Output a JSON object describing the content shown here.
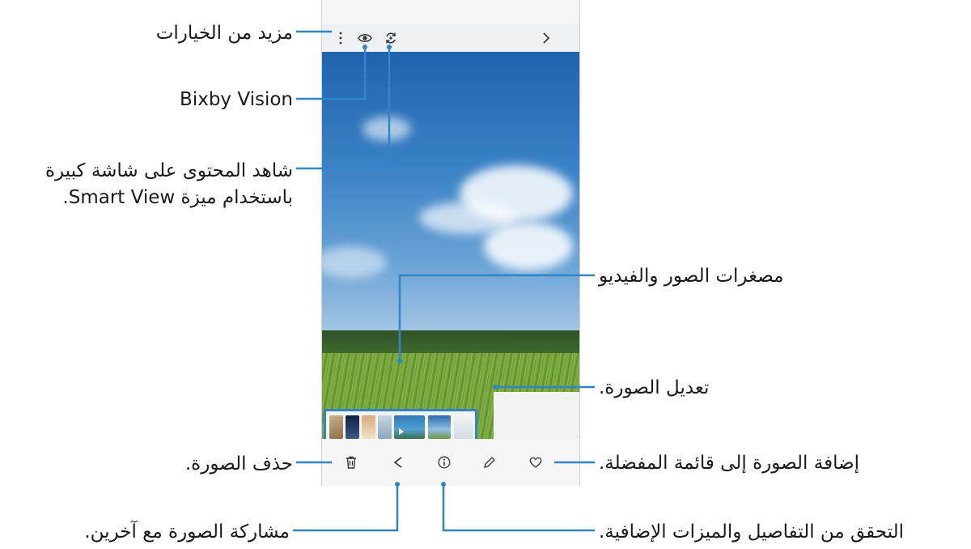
{
  "labels": {
    "more_options": "مزيد من الخيارات",
    "bixby_vision": "Bixby Vision",
    "smart_view_line1": "شاهد المحتوى على شاشة كبيرة",
    "smart_view_line2": "باستخدام ميزة Smart View.",
    "thumbnails": "مصغرات الصور والفيديو",
    "edit": "تعديل الصورة.",
    "favorite": "إضافة الصورة إلى قائمة المفضلة.",
    "delete": "حذف الصورة.",
    "share": "مشاركة الصورة مع آخرين.",
    "details": "التحقق من التفاصيل والميزات الإضافية."
  },
  "icons": {
    "more": "more-vertical-icon",
    "bixby": "eye-icon",
    "smart_view": "smart-view-icon",
    "back": "chevron-right-icon",
    "delete": "trash-icon",
    "share": "share-icon",
    "details": "info-icon",
    "edit": "pencil-icon",
    "favorite": "heart-icon"
  },
  "colors": {
    "callout_line": "#2e86c8",
    "thumbnail_border": "#2e86c8"
  }
}
